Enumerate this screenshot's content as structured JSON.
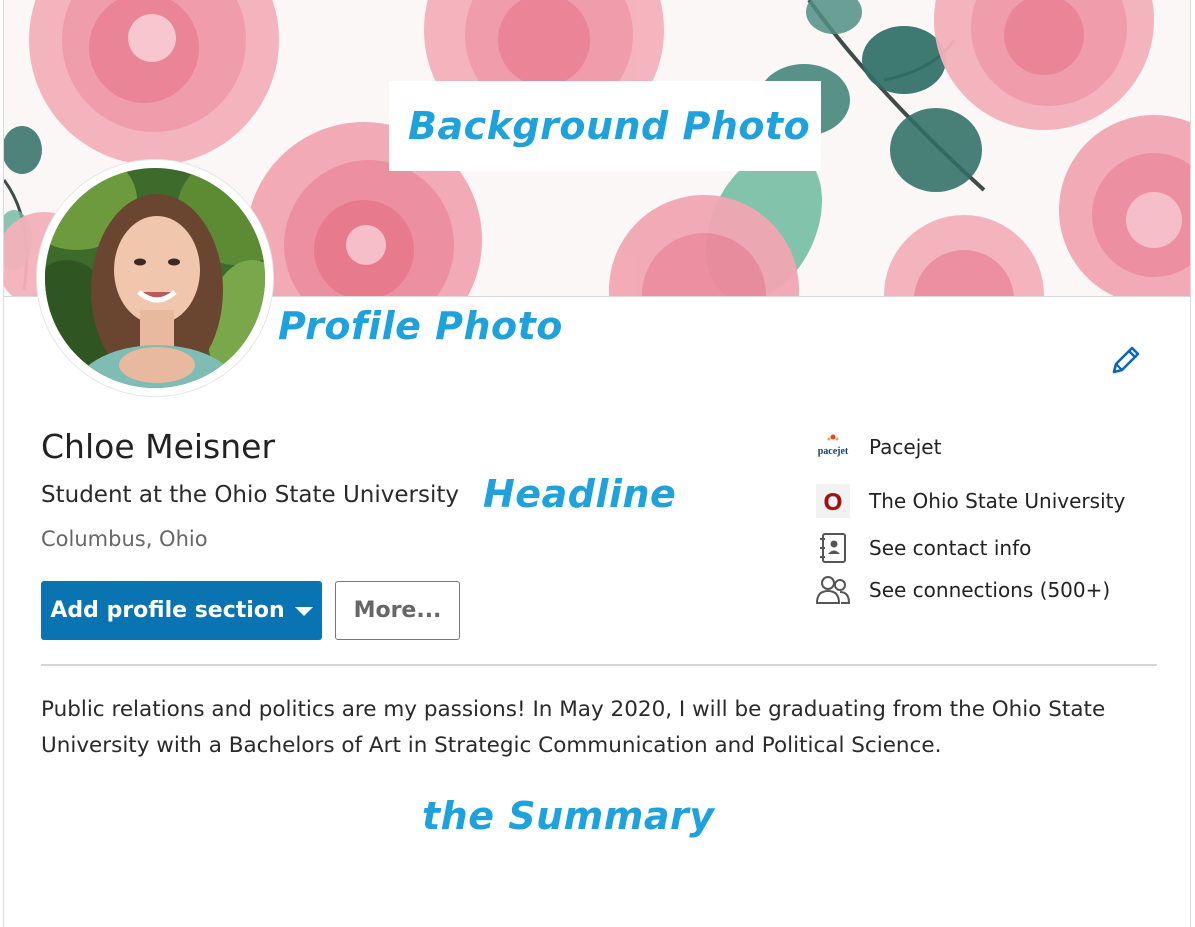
{
  "annotations": {
    "background_photo": "Background Photo",
    "profile_photo": "Profile Photo",
    "headline": "Headline",
    "summary": "the Summary"
  },
  "profile": {
    "name": "Chloe Meisner",
    "headline": "Student at the Ohio State University",
    "location": "Columbus, Ohio",
    "summary": "Public relations and politics are my passions! In May 2020, I will be graduating from the Ohio State University with a Bachelors of Art in Strategic Communication and Political Science."
  },
  "actions": {
    "add_profile_section": "Add profile section",
    "more": "More..."
  },
  "sidebar": {
    "items": [
      {
        "label": "Pacejet",
        "icon": "pacejet-logo-icon",
        "logo_text": "pacejet"
      },
      {
        "label": "The Ohio State University",
        "icon": "ohio-state-logo-icon",
        "logo_text": "O"
      },
      {
        "label": "See contact info",
        "icon": "contact-card-icon"
      },
      {
        "label": "See connections (500+)",
        "icon": "people-icon"
      }
    ]
  },
  "colors": {
    "primary_button": "#0a73b1",
    "annotation_blue": "#1ea2dd",
    "rose_pink": "#ec8a9c",
    "leaf_green": "#4f9f86",
    "osu_scarlet": "#bb0000"
  }
}
